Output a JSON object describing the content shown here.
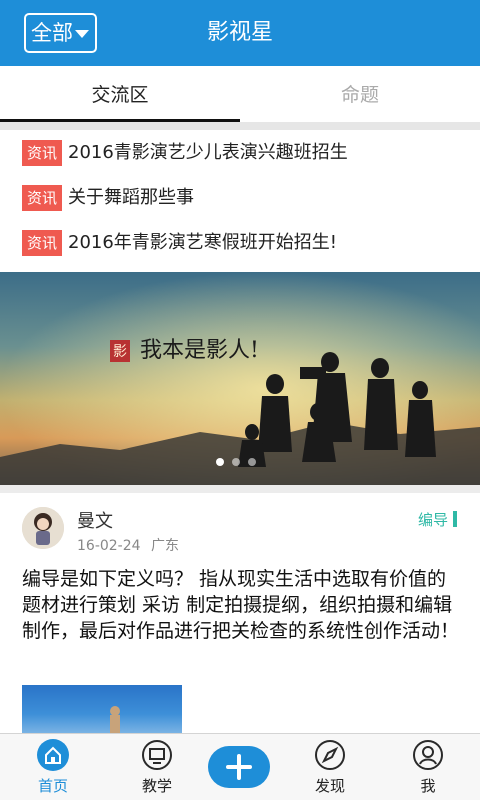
{
  "header": {
    "filter_label": "全部",
    "title": "影视星"
  },
  "tabs": [
    {
      "label": "交流区"
    },
    {
      "label": "命题"
    }
  ],
  "news": [
    {
      "tag": "资讯",
      "title": "2016青影演艺少儿表演兴趣班招生"
    },
    {
      "tag": "资讯",
      "title": "关于舞蹈那些事"
    },
    {
      "tag": "资讯",
      "title": "2016年青影演艺寒假班开始招生!"
    }
  ],
  "banner": {
    "slogan": "我本是影人!",
    "seal": "影",
    "slide_count": 3,
    "active_slide": 1
  },
  "post": {
    "author": "曼文",
    "date": "16-02-24",
    "location": "广东",
    "category": "编导",
    "body": "编导是如下定义吗？ 指从现实生活中选取有价值的题材进行策划 采访 制定拍摄提纲，组织拍摄和编辑制作，最后对作品进行把关检查的系统性创作活动！"
  },
  "bottom_nav": [
    {
      "label": "首页",
      "icon": "home-icon",
      "active": true
    },
    {
      "label": "教学",
      "icon": "monitor-icon",
      "active": false
    },
    {
      "label": "",
      "icon": "plus-icon",
      "active": false
    },
    {
      "label": "发现",
      "icon": "compass-icon",
      "active": false
    },
    {
      "label": "我",
      "icon": "user-icon",
      "active": false
    }
  ],
  "colors": {
    "primary": "#1e8ed8",
    "tag": "#ef5a50",
    "category": "#2fb9a6"
  }
}
